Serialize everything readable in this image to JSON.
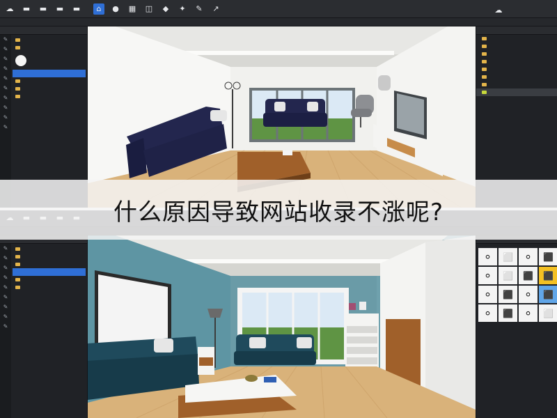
{
  "banner": {
    "title": "什么原因导致网站收录不涨呢?"
  },
  "colors": {
    "accent": "#2f6fd6",
    "folder": "#e3b44a",
    "panel_bg": "#202226",
    "wall_top": "#f2f2f2",
    "wall_bottom": "#6fa1ad",
    "floor": "#d9b27a",
    "sofa_top": "#23264e",
    "sofa_bottom": "#1f4a5c"
  },
  "icons": [
    "dropdown-arrow-icon",
    "home-plan-icon",
    "globe-icon",
    "grid-icon",
    "layers-icon",
    "view-3d-icon",
    "tools-icon",
    "pencil-icon",
    "arrow-icon",
    "furniture-catalog-icon"
  ]
}
